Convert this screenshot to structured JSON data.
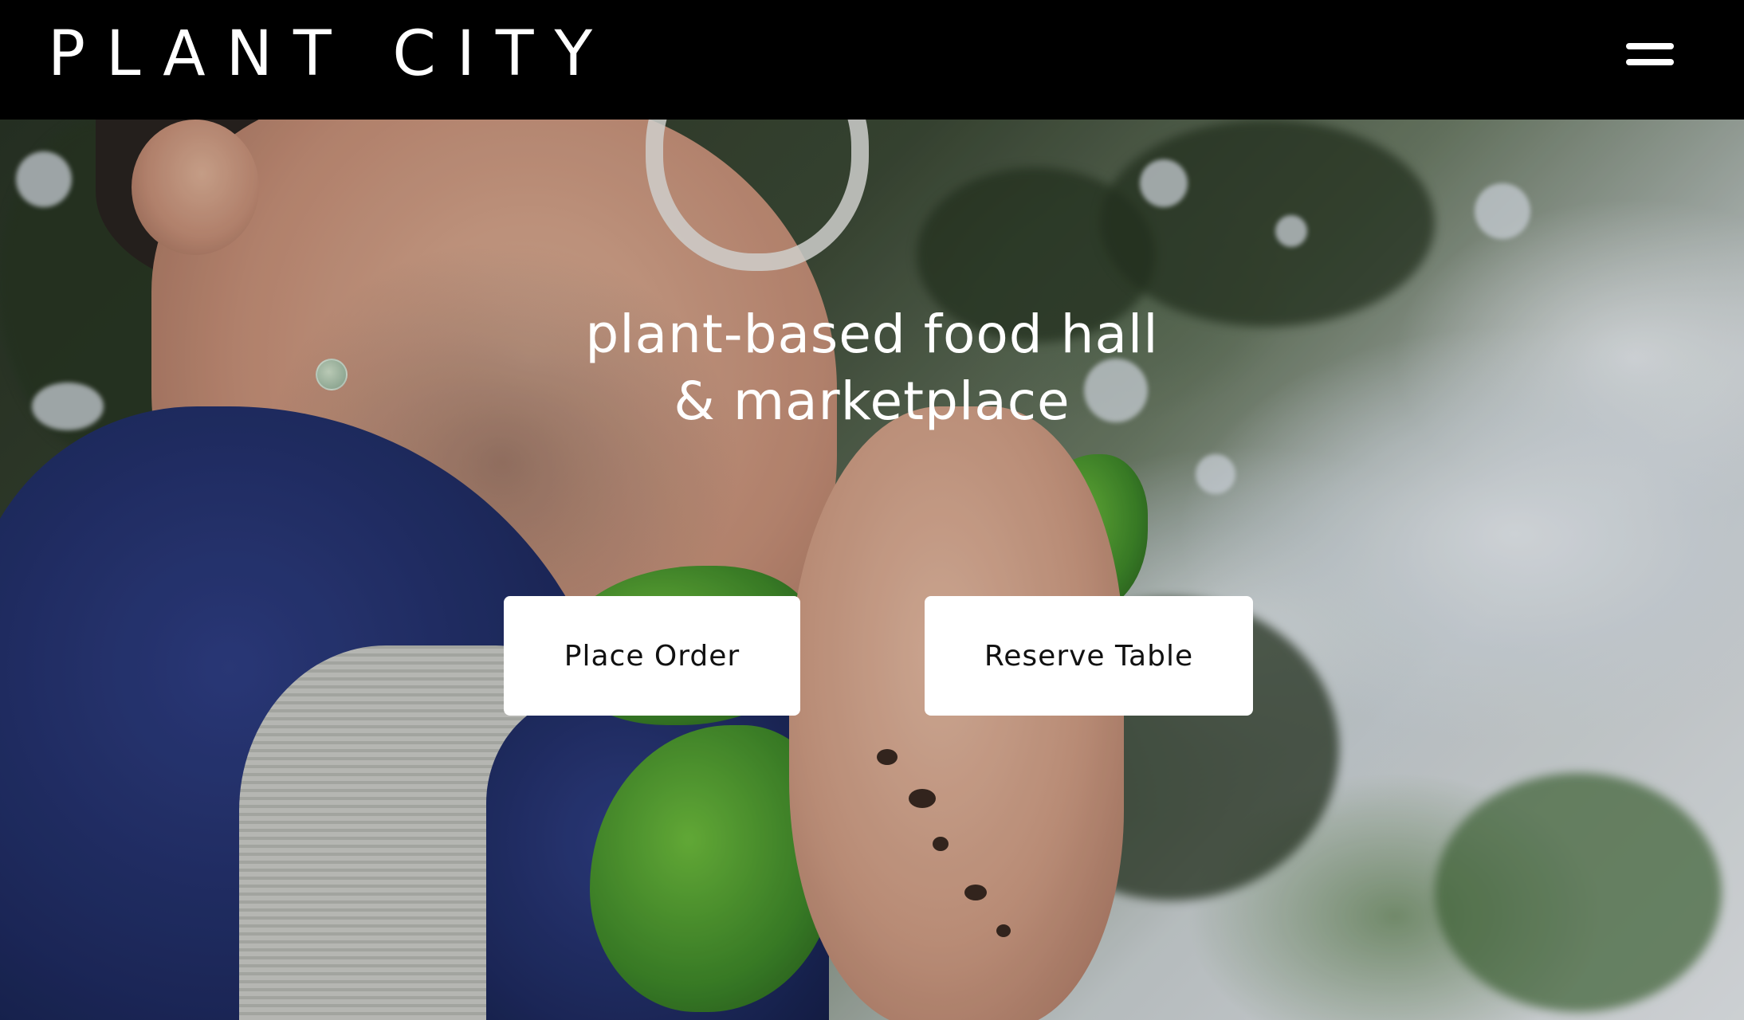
{
  "header": {
    "logo_text": "PLANT CITY",
    "menu_icon": "hamburger-menu-icon"
  },
  "hero": {
    "headline_line1": "plant-based food hall",
    "headline_line2": "& marketplace",
    "buttons": {
      "place_order": "Place Order",
      "reserve_table": "Reserve Table"
    }
  },
  "colors": {
    "header_bg": "#000000",
    "button_bg": "#ffffff",
    "button_text": "#111111",
    "headline_text": "#ffffff"
  }
}
